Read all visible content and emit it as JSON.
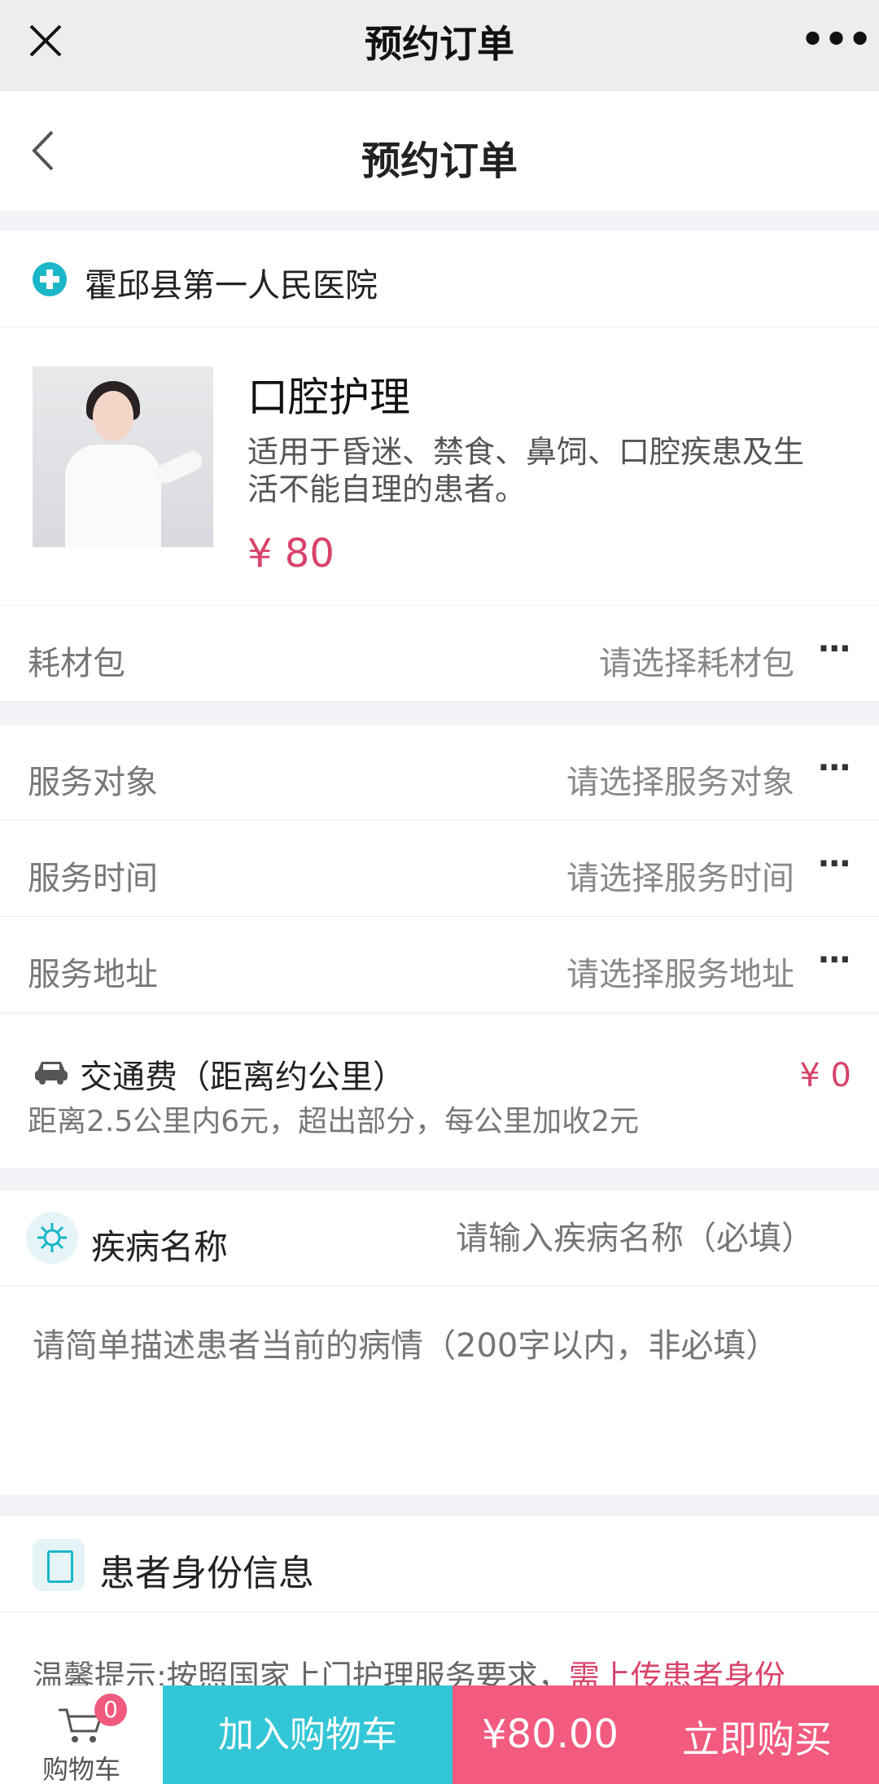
{
  "wx": {
    "title": "预约订单"
  },
  "nav": {
    "title": "预约订单"
  },
  "hospital": {
    "name": "霍邱县第一人民医院"
  },
  "product": {
    "title": "口腔护理",
    "description": "适用于昏迷、禁食、鼻饲、口腔疾患及生活不能自理的患者。",
    "price": "¥ 80"
  },
  "rows": {
    "consumables": {
      "label": "耗材包",
      "value": "请选择耗材包"
    },
    "service_target": {
      "label": "服务对象",
      "value": "请选择服务对象"
    },
    "service_time": {
      "label": "服务时间",
      "value": "请选择服务时间"
    },
    "service_address": {
      "label": "服务地址",
      "value": "请选择服务地址"
    }
  },
  "traffic": {
    "title": "交通费（距离约公里）",
    "subtitle": "距离2.5公里内6元，超出部分，每公里加收2元",
    "price": "¥ 0"
  },
  "disease": {
    "label": "疾病名称",
    "placeholder": "请输入疾病名称（必填）",
    "description_placeholder": "请简单描述患者当前的病情（200字以内，非必填）"
  },
  "patient_id": {
    "title": "患者身份信息",
    "tip_prefix": "温馨提示:按照国家上门护理服务要求，",
    "tip_highlight": "需上传患者身份"
  },
  "bottom": {
    "cart_label": "购物车",
    "cart_count": "0",
    "add_to_cart": "加入购物车",
    "total": "¥80.00",
    "buy_now": "立即购买"
  },
  "colors": {
    "accent": "#1bb7c9",
    "price": "#d8436b",
    "cart_button": "#33c6d6",
    "buy_button": "#f25a7f"
  }
}
